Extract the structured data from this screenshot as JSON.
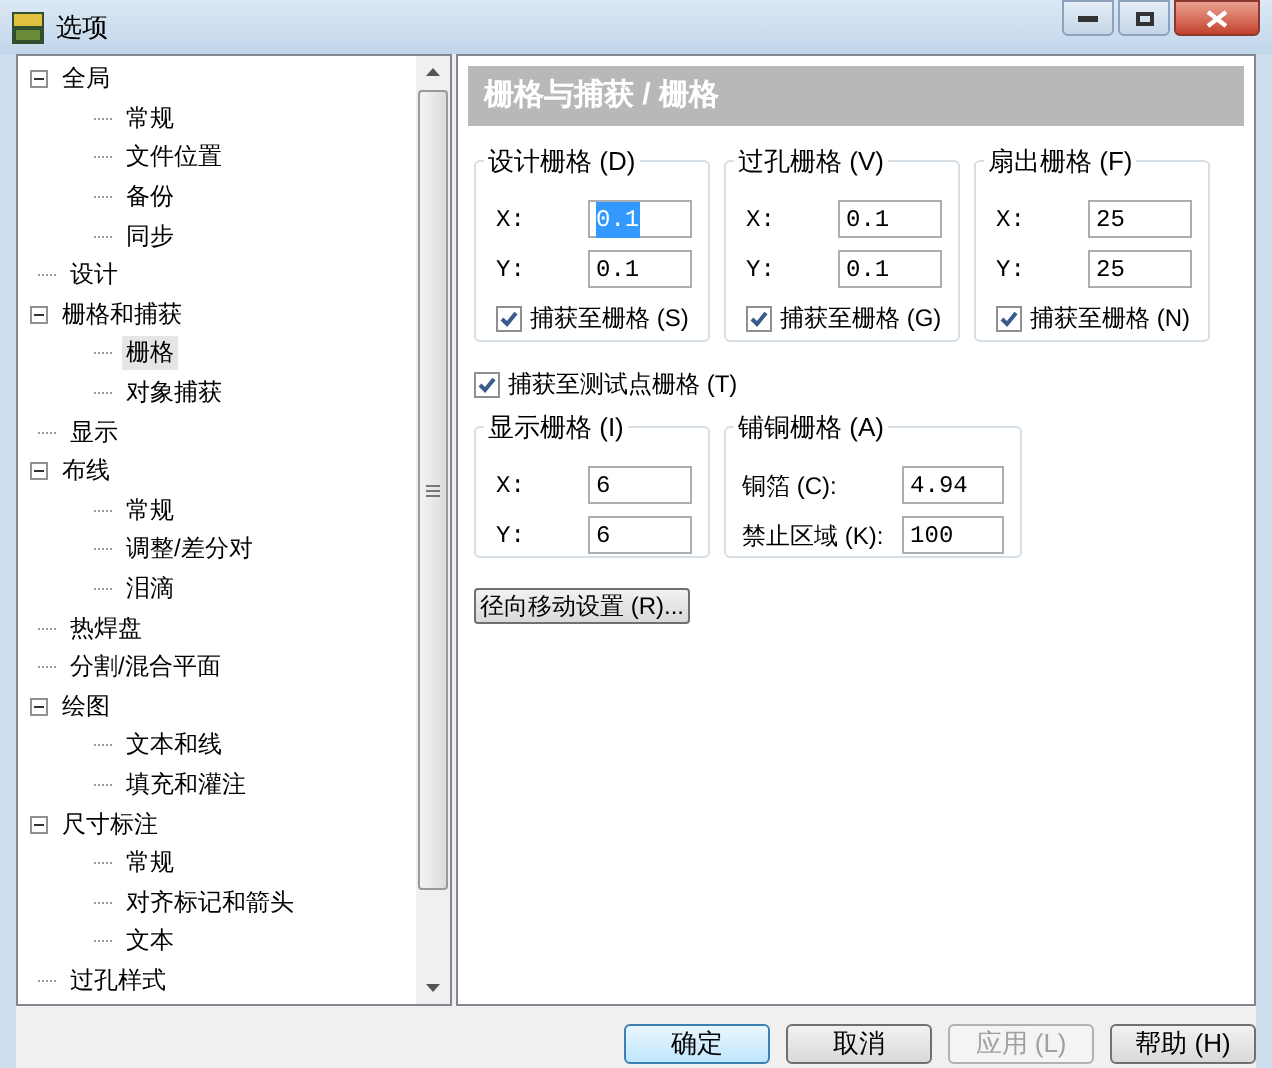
{
  "window": {
    "title": "选项"
  },
  "tree": [
    {
      "label": "全局",
      "expanded": true,
      "selected": false,
      "children": [
        {
          "label": "常规",
          "selected": false
        },
        {
          "label": "文件位置",
          "selected": false
        },
        {
          "label": "备份",
          "selected": false
        },
        {
          "label": "同步",
          "selected": false
        }
      ]
    },
    {
      "label": "设计",
      "selected": false
    },
    {
      "label": "栅格和捕获",
      "expanded": true,
      "selected": false,
      "children": [
        {
          "label": "栅格",
          "selected": true
        },
        {
          "label": "对象捕获",
          "selected": false
        }
      ]
    },
    {
      "label": "显示",
      "selected": false
    },
    {
      "label": "布线",
      "expanded": true,
      "selected": false,
      "children": [
        {
          "label": "常规",
          "selected": false
        },
        {
          "label": "调整/差分对",
          "selected": false
        },
        {
          "label": "泪滴",
          "selected": false
        }
      ]
    },
    {
      "label": "热焊盘",
      "selected": false
    },
    {
      "label": "分割/混合平面",
      "selected": false
    },
    {
      "label": "绘图",
      "expanded": true,
      "selected": false,
      "children": [
        {
          "label": "文本和线",
          "selected": false
        },
        {
          "label": "填充和灌注",
          "selected": false
        }
      ]
    },
    {
      "label": "尺寸标注",
      "expanded": true,
      "selected": false,
      "children": [
        {
          "label": "常规",
          "selected": false
        },
        {
          "label": "对齐标记和箭头",
          "selected": false
        },
        {
          "label": "文本",
          "selected": false
        }
      ]
    },
    {
      "label": "过孔样式",
      "selected": false
    }
  ],
  "page_header": "栅格与捕获 / 栅格",
  "grid_groups": [
    {
      "title": "设计栅格 (D)",
      "fields": [
        {
          "label": "X:",
          "value": "0.1",
          "selected": true
        },
        {
          "label": "Y:",
          "value": "0.1",
          "selected": false
        }
      ],
      "snap": {
        "label": "捕获至栅格 (S)",
        "checked": true
      }
    },
    {
      "title": "过孔栅格 (V)",
      "fields": [
        {
          "label": "X:",
          "value": "0.1",
          "selected": false
        },
        {
          "label": "Y:",
          "value": "0.1",
          "selected": false
        }
      ],
      "snap": {
        "label": "捕获至栅格 (G)",
        "checked": true
      }
    },
    {
      "title": "扇出栅格 (F)",
      "fields": [
        {
          "label": "X:",
          "value": "25",
          "selected": false
        },
        {
          "label": "Y:",
          "value": "25",
          "selected": false
        }
      ],
      "snap": {
        "label": "捕获至栅格 (N)",
        "checked": true
      }
    }
  ],
  "testpoint_snap": {
    "label": "捕获至测试点栅格 (T)",
    "checked": true
  },
  "display_grid": {
    "title": "显示栅格 (I)",
    "fields": [
      {
        "label": "X:",
        "value": "6"
      },
      {
        "label": "Y:",
        "value": "6"
      }
    ]
  },
  "copper_grid": {
    "title": "铺铜栅格 (A)",
    "fields": [
      {
        "label": "铜箔 (C):",
        "value": "4.94"
      },
      {
        "label": "禁止区域 (K):",
        "value": "100"
      }
    ]
  },
  "radial_button": "径向移动设置 (R)...",
  "buttons": [
    {
      "label": "确定",
      "disabled": false,
      "default": true
    },
    {
      "label": "取消",
      "disabled": false,
      "default": false
    },
    {
      "label": "应用 (L)",
      "disabled": true,
      "default": false
    },
    {
      "label": "帮助 (H)",
      "disabled": false,
      "default": false
    }
  ]
}
